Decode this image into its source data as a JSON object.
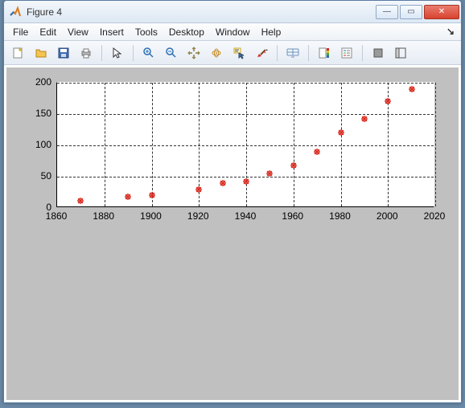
{
  "window": {
    "title": "Figure 4",
    "minimize_glyph": "—",
    "maximize_glyph": "▭",
    "close_glyph": "✕"
  },
  "menu": {
    "items": [
      "File",
      "Edit",
      "View",
      "Insert",
      "Tools",
      "Desktop",
      "Window",
      "Help"
    ],
    "dock_glyph": "↘"
  },
  "toolbar_icons": [
    "new-figure-icon",
    "open-icon",
    "save-icon",
    "print-icon",
    "|",
    "pointer-icon",
    "|",
    "zoom-in-icon",
    "zoom-out-icon",
    "pan-icon",
    "rotate3d-icon",
    "datacursor-icon",
    "brush-icon",
    "|",
    "link-icon",
    "|",
    "colorbar-icon",
    "legend-icon",
    "|",
    "hide-tools-icon",
    "show-tools-icon"
  ],
  "chart_data": {
    "type": "scatter",
    "x": [
      1870,
      1890,
      1900,
      1920,
      1930,
      1940,
      1950,
      1960,
      1970,
      1980,
      1990,
      2000,
      2010
    ],
    "y": [
      12,
      18,
      20,
      30,
      40,
      42,
      55,
      68,
      90,
      120,
      142,
      170,
      190
    ],
    "xlabel": "",
    "ylabel": "",
    "title": "",
    "xlim": [
      1860,
      2020
    ],
    "ylim": [
      0,
      200
    ],
    "xticks": [
      1860,
      1880,
      1900,
      1920,
      1940,
      1960,
      1980,
      2000,
      2020
    ],
    "yticks": [
      0,
      50,
      100,
      150,
      200
    ],
    "grid": true,
    "marker": "asterisk",
    "marker_color": "#d8271c"
  }
}
